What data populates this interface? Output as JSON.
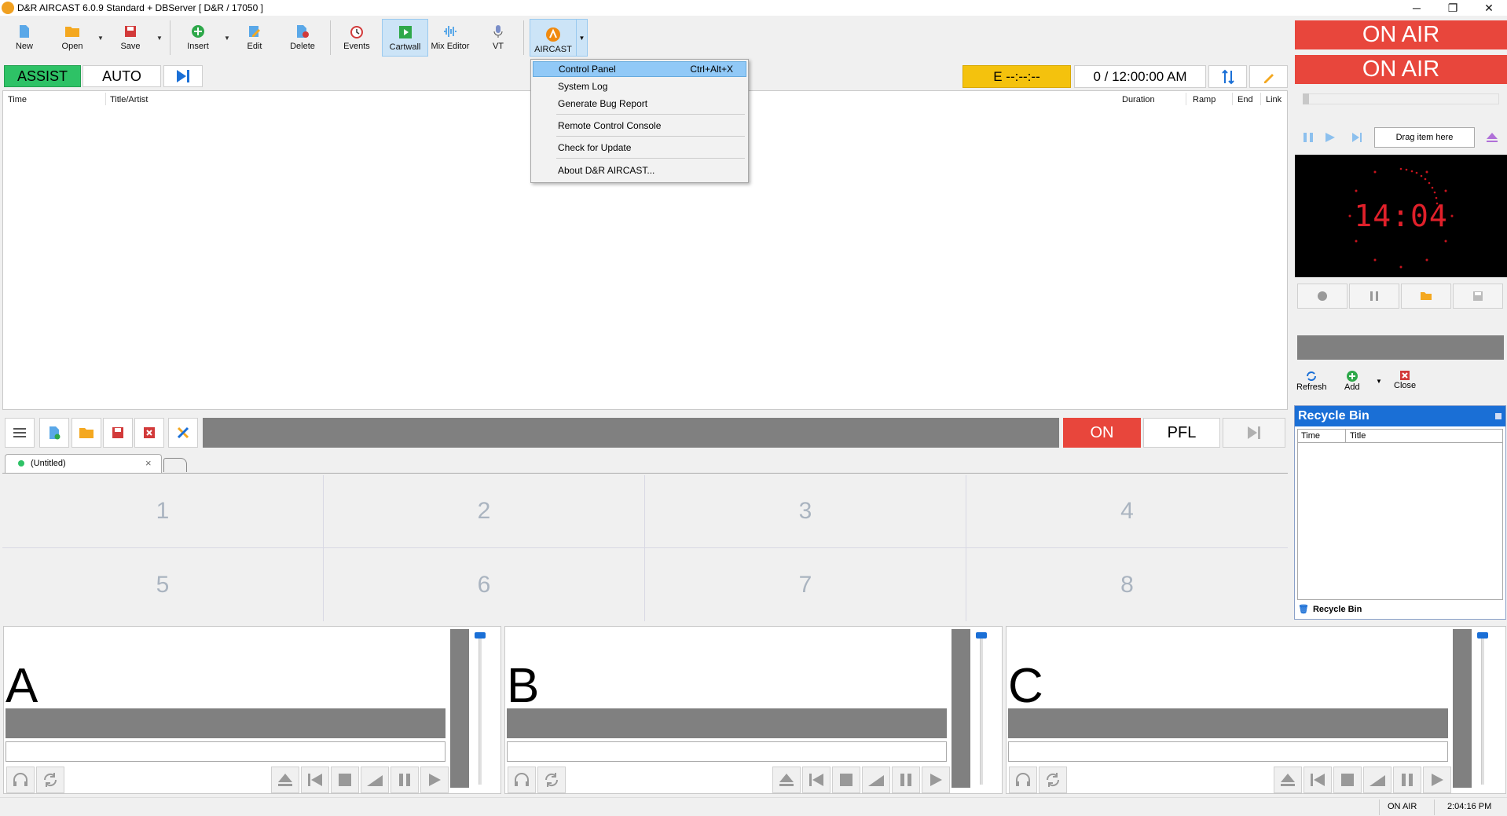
{
  "window": {
    "title": "D&R AIRCAST 6.0.9 Standard + DBServer [ D&R / 17050 ]",
    "controls": [
      "─",
      "❐",
      "✕"
    ]
  },
  "toolbar": {
    "new": "New",
    "open": "Open",
    "save": "Save",
    "insert": "Insert",
    "edit": "Edit",
    "delete": "Delete",
    "events": "Events",
    "cartwall": "Cartwall",
    "mix_editor": "Mix Editor",
    "vt": "VT",
    "aircast": "AIRCAST"
  },
  "mode": {
    "assist": "ASSIST",
    "auto": "AUTO",
    "event_timer": "E  --:--:--",
    "clock": "0 / 12:00:00 AM"
  },
  "playlist": {
    "columns": {
      "time": "Time",
      "title_artist": "Title/Artist",
      "duration": "Duration",
      "ramp": "Ramp",
      "end": "End",
      "link": "Link"
    }
  },
  "menu": {
    "items": [
      {
        "label": "Control Panel",
        "shortcut": "Ctrl+Alt+X"
      },
      {
        "label": "System Log"
      },
      {
        "label": "Generate Bug Report"
      },
      {
        "label": "Remote Control Console"
      },
      {
        "label": "Check for Update"
      },
      {
        "label": "About D&R AIRCAST..."
      }
    ]
  },
  "midbar": {
    "on": "ON",
    "pfl": "PFL"
  },
  "tabs": {
    "untitled": "(Untitled)",
    "close": "×"
  },
  "carts": [
    "1",
    "2",
    "3",
    "4",
    "5",
    "6",
    "7",
    "8"
  ],
  "players": [
    {
      "letter": "A"
    },
    {
      "letter": "B"
    },
    {
      "letter": "C"
    }
  ],
  "right_panel": {
    "on_air_1": "ON AIR",
    "on_air_2": "ON AIR",
    "drag_here": "Drag item here",
    "clock_display": "14:04",
    "refresh": "Refresh",
    "add": "Add",
    "close": "Close"
  },
  "recycle_bin": {
    "title": "Recycle Bin",
    "col_time": "Time",
    "col_title": "Title",
    "footer": "Recycle Bin"
  },
  "status": {
    "on_air": "ON AIR",
    "time": "2:04:16 PM"
  },
  "colors": {
    "assist_green": "#2ec266",
    "on_air_red": "#e8463c",
    "event_yellow": "#f4c20d",
    "accent_blue": "#1a6fd6",
    "bar_gray": "#808080"
  }
}
